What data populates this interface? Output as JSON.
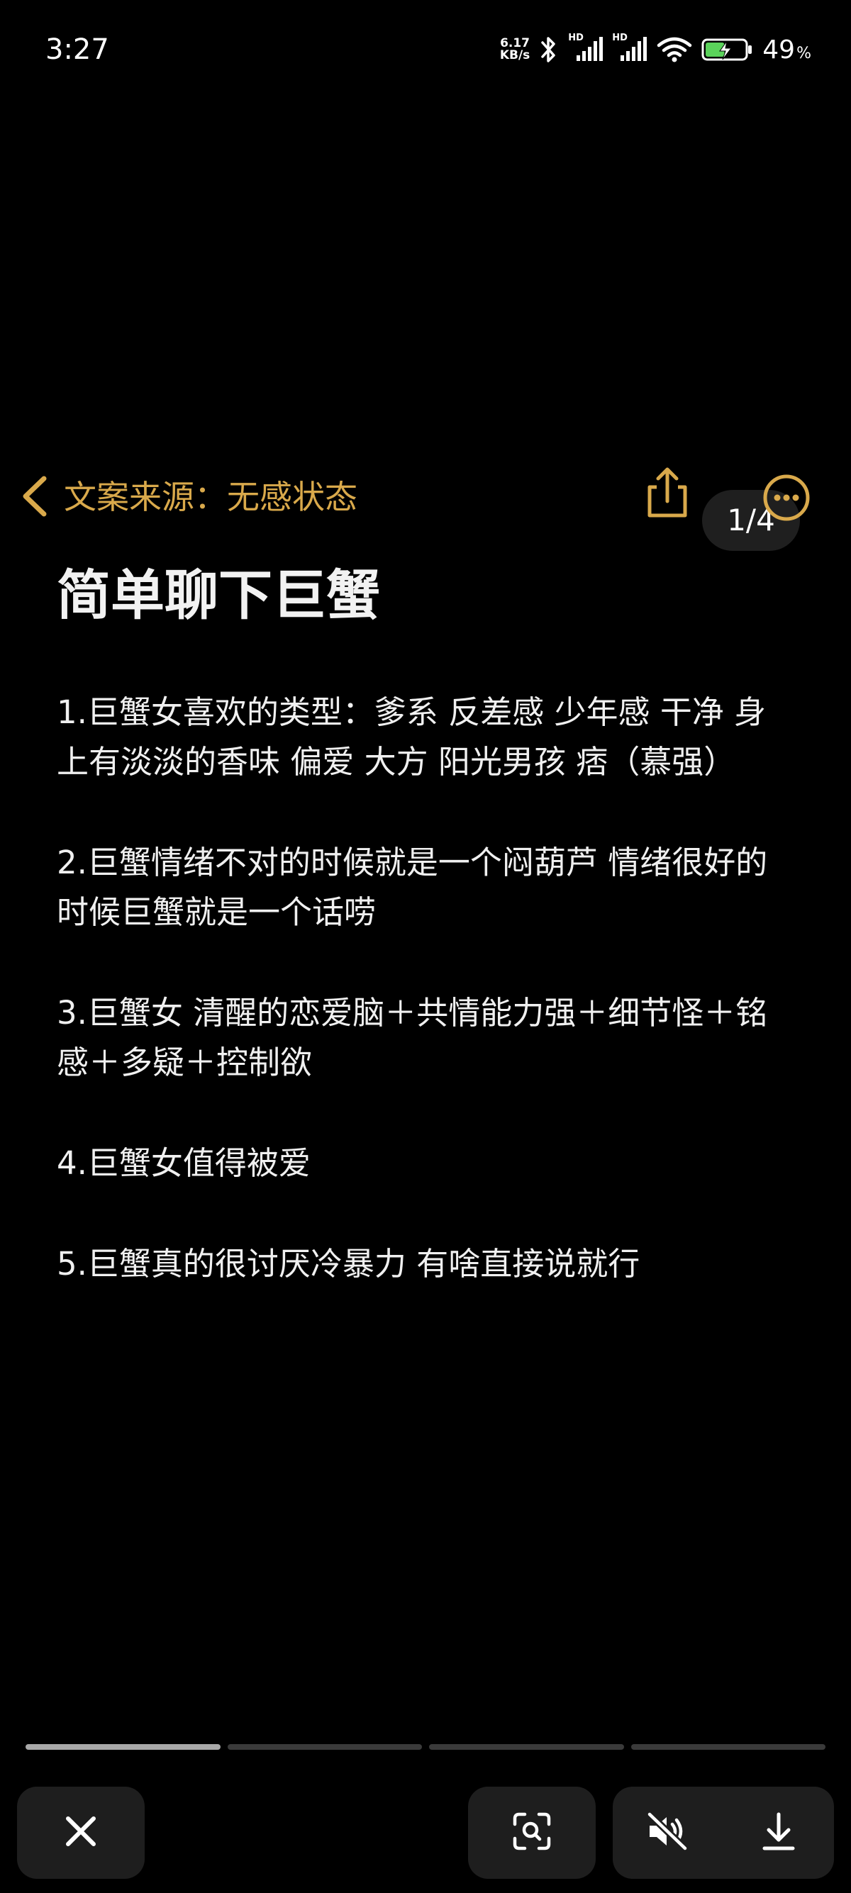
{
  "status_bar": {
    "time": "3:27",
    "net_speed_value": "6.17",
    "net_speed_unit": "KB/s",
    "signal1_label": "HD",
    "signal2_label": "HD",
    "battery_percent": "49",
    "battery_unit": "%",
    "battery_level": 0.49,
    "battery_color": "#5bd35b"
  },
  "header": {
    "source_label": "文案来源：无感状态",
    "page_indicator": "1/4",
    "accent_color": "#d9a94b"
  },
  "note": {
    "title": "简单聊下巨蟹",
    "items": [
      "1.巨蟹女喜欢的类型：爹系 反差感 少年感 干净 身上有淡淡的香味 偏爱 大方 阳光男孩 痞（慕强）",
      "2.巨蟹情绪不对的时候就是一个闷葫芦 情绪很好的时候巨蟹就是一个话唠",
      "3.巨蟹女 清醒的恋爱脑＋共情能力强＋细节怪＋铭感＋多疑＋控制欲",
      "4.巨蟹女值得被爱",
      "5.巨蟹真的很讨厌冷暴力 有啥直接说就行"
    ]
  },
  "progress": {
    "total": 4,
    "current": 1
  },
  "controls": {
    "close_icon": "close-icon",
    "scan_icon": "scan-icon",
    "mute_icon": "speaker-muted-icon",
    "download_icon": "download-icon"
  }
}
